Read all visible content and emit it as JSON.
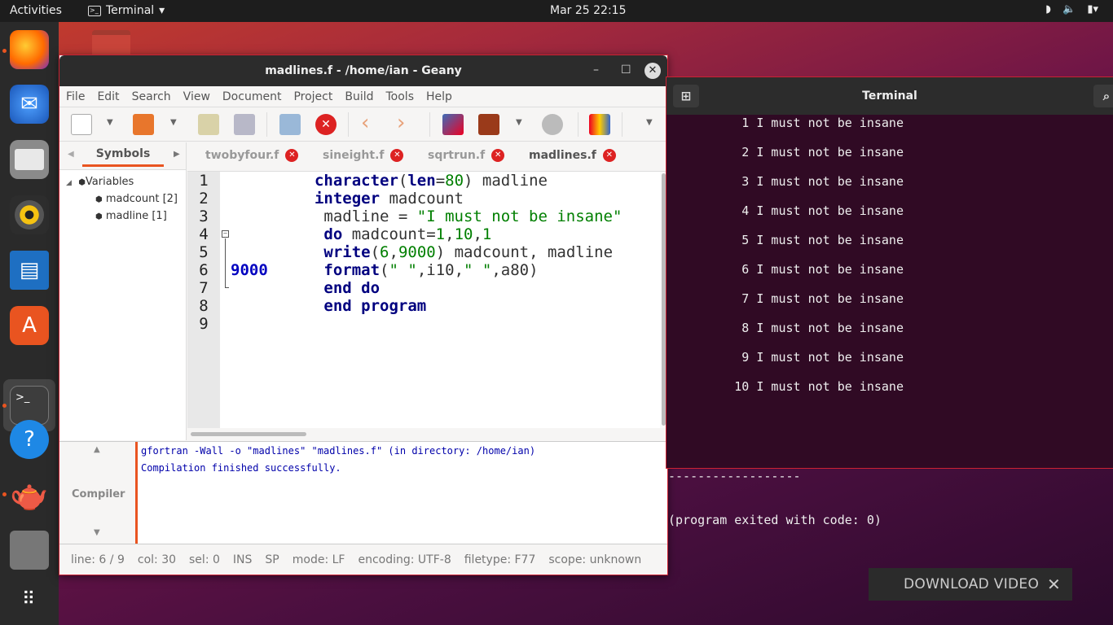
{
  "topbar": {
    "activities": "Activities",
    "app": "Terminal",
    "clock": "Mar 25  22:15",
    "tray": [
      "wifi-icon",
      "volume-icon",
      "battery-icon"
    ]
  },
  "dock": {
    "items": [
      "firefox",
      "thunderbird",
      "files",
      "rhythmbox",
      "libreoffice-writer",
      "ubuntu-software",
      "terminal",
      "help",
      "geany",
      "sd-card",
      "show-applications"
    ]
  },
  "geany": {
    "title": "madlines.f - /home/ian - Geany",
    "menu": [
      "File",
      "Edit",
      "Search",
      "View",
      "Document",
      "Project",
      "Build",
      "Tools",
      "Help"
    ],
    "sidebar": {
      "tab": "Symbols",
      "tree": {
        "group": "Variables",
        "items": [
          "madcount [2]",
          "madline [1]"
        ]
      }
    },
    "tabs": [
      "twobyfour.f",
      "sineight.f",
      "sqrtrun.f",
      "madlines.f"
    ],
    "active_tab": "madlines.f",
    "line_numbers": [
      "1",
      "2",
      "3",
      "4",
      "5",
      "6",
      "7",
      "8",
      "9"
    ],
    "code": [
      [
        {
          "t": "         "
        },
        {
          "t": "character",
          "c": "kw"
        },
        {
          "t": "("
        },
        {
          "t": "len",
          "c": "kw"
        },
        {
          "t": "="
        },
        {
          "t": "80",
          "c": "num"
        },
        {
          "t": ") madline"
        }
      ],
      [
        {
          "t": "         "
        },
        {
          "t": "integer",
          "c": "kw"
        },
        {
          "t": " madcount"
        }
      ],
      [
        {
          "t": "          madline = "
        },
        {
          "t": "\"I must not be insane\"",
          "c": "str"
        }
      ],
      [
        {
          "t": "          "
        },
        {
          "t": "do",
          "c": "kw"
        },
        {
          "t": " madcount="
        },
        {
          "t": "1",
          "c": "num"
        },
        {
          "t": ","
        },
        {
          "t": "10",
          "c": "num"
        },
        {
          "t": ","
        },
        {
          "t": "1",
          "c": "num"
        }
      ],
      [
        {
          "t": "          "
        },
        {
          "t": "write",
          "c": "kw"
        },
        {
          "t": "("
        },
        {
          "t": "6",
          "c": "num"
        },
        {
          "t": ","
        },
        {
          "t": "9000",
          "c": "num"
        },
        {
          "t": ") madcount, madline"
        }
      ],
      [
        {
          "t": "9000",
          "c": "lbl"
        },
        {
          "t": "      "
        },
        {
          "t": "format",
          "c": "kw"
        },
        {
          "t": "("
        },
        {
          "t": "\" \"",
          "c": "str"
        },
        {
          "t": ",i10,"
        },
        {
          "t": "\" \"",
          "c": "str"
        },
        {
          "t": ",a80)"
        }
      ],
      [
        {
          "t": "          "
        },
        {
          "t": "end do",
          "c": "kw"
        }
      ],
      [
        {
          "t": "          "
        },
        {
          "t": "end program",
          "c": "kw"
        }
      ],
      [
        {
          "t": ""
        }
      ]
    ],
    "compiler": {
      "label": "Compiler",
      "lines": [
        "gfortran -Wall -o \"madlines\" \"madlines.f\" (in directory: /home/ian)",
        "Compilation finished successfully."
      ]
    },
    "status": [
      "line: 6 / 9",
      "col: 30",
      "sel: 0",
      "INS",
      "SP",
      "mode: LF",
      "encoding: UTF-8",
      "filetype: F77",
      "scope: unknown"
    ]
  },
  "terminal": {
    "title": "Terminal",
    "lines": [
      "          1 I must not be insane",
      "          2 I must not be insane",
      "          3 I must not be insane",
      "          4 I must not be insane",
      "          5 I must not be insane",
      "          6 I must not be insane",
      "          7 I must not be insane",
      "          8 I must not be insane",
      "          9 I must not be insane",
      "         10 I must not be insane"
    ],
    "separator": "------------------",
    "exit": "(program exited with code: 0)"
  },
  "download": {
    "label": "DOWNLOAD VIDEO",
    "close": "✕"
  }
}
